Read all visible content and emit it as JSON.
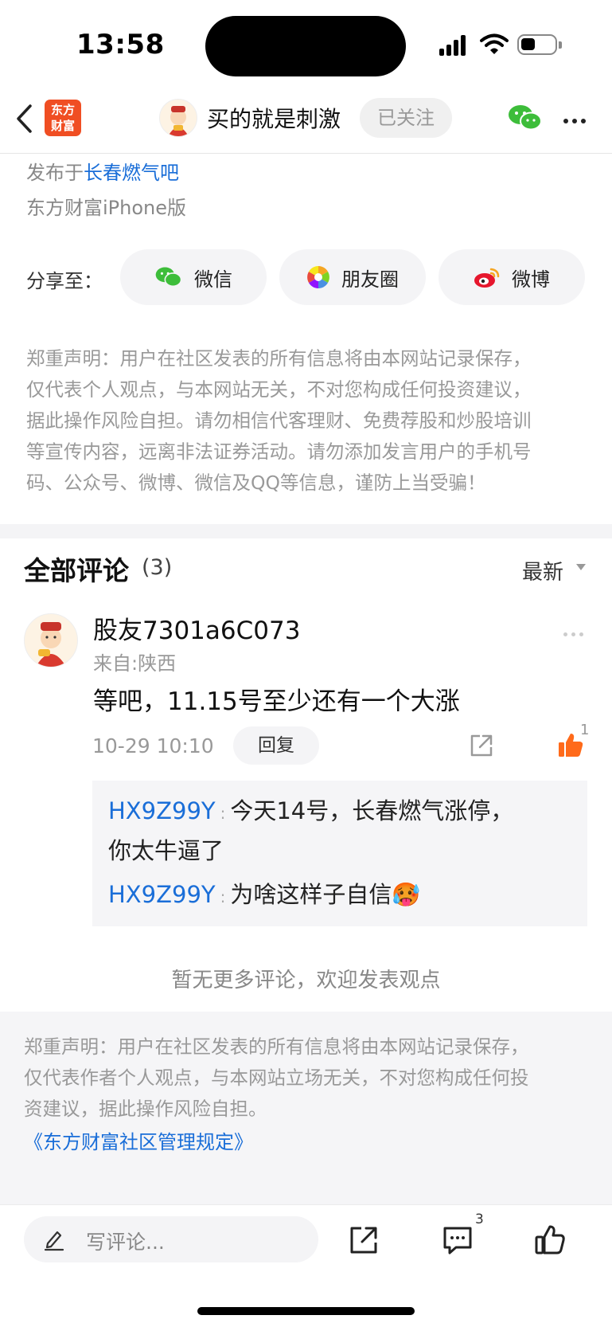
{
  "status_bar": {
    "time": "13:58"
  },
  "nav": {
    "logo_line1": "东方",
    "logo_line2": "财富",
    "title": "买的就是刺激",
    "follow_label": "已关注"
  },
  "post_meta": {
    "published_prefix": "发布于",
    "forum_name": "长春燃气吧",
    "client": "东方财富iPhone版"
  },
  "share": {
    "label": "分享至：",
    "options": [
      {
        "label": "微信",
        "icon": "wechat-icon"
      },
      {
        "label": "朋友圈",
        "icon": "moments-icon"
      },
      {
        "label": "微博",
        "icon": "weibo-icon"
      }
    ]
  },
  "disclaimer_top": {
    "lines": [
      "郑重声明：用户在社区发表的所有信息将由本网站记录保存，",
      "仅代表个人观点，与本网站无关，不对您构成任何投资建议，",
      "据此操作风险自担。请勿相信代客理财、免费荐股和炒股培训",
      "等宣传内容，远离非法证券活动。请勿添加发言用户的手机号",
      "码、公众号、微博、微信及QQ等信息，谨防上当受骗！"
    ]
  },
  "comments": {
    "title": "全部评论",
    "count": "(3)",
    "sort_label": "最新",
    "items": [
      {
        "user": "股友7301a6C073",
        "location": "来自:陕西",
        "text": "等吧，11.15号至少还有一个大涨",
        "time": "10-29 10:10",
        "reply_label": "回复",
        "like_count": "1",
        "replies": [
          {
            "user": "HX9Z99Y",
            "separator": ":",
            "text_line1": "今天14号，长春燃气涨停，",
            "text_line2": "你太牛逼了"
          },
          {
            "user": "HX9Z99Y",
            "separator": ":",
            "text_line1": "为啥这样子自信",
            "emoji": "🥵"
          }
        ]
      }
    ],
    "no_more": "暂无更多评论，欢迎发表观点"
  },
  "disclaimer_bottom": {
    "lines": [
      "郑重声明：用户在社区发表的所有信息将由本网站记录保存，",
      "仅代表作者个人观点，与本网站立场无关，不对您构成任何投",
      "资建议，据此操作风险自担。"
    ],
    "link": "《东方财富社区管理规定》"
  },
  "bottom_bar": {
    "input_placeholder": "写评论...",
    "comment_count": "3"
  },
  "colors": {
    "accent_blue": "#1a6ed8",
    "brand_orange": "#f04e23",
    "like_orange": "#ff6a1a",
    "wechat_green": "#3dbd3a"
  }
}
